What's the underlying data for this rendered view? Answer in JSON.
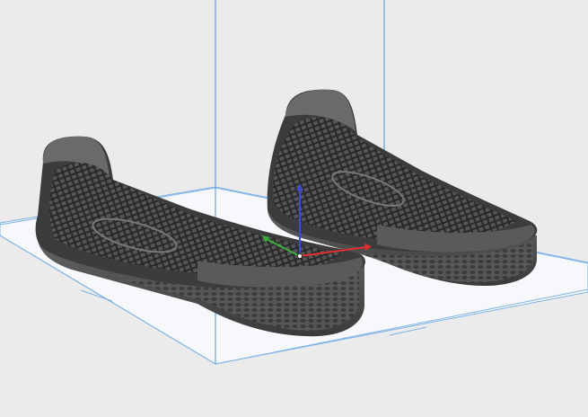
{
  "viewport": {
    "background": "#ebebeb",
    "build_plate_color": "#f7f9fb",
    "build_volume_edge_color": "#4a90d9",
    "model_color": "#4a4a4a",
    "model_highlight_color": "#7a7a7a",
    "model_dark_color": "#1e1e1e"
  },
  "models": [
    {
      "name": "left-shoe-sole"
    },
    {
      "name": "right-shoe-sole"
    }
  ],
  "gizmo": {
    "x_color": "#e03030",
    "y_color": "#3ab03a",
    "z_color": "#3a4bd0"
  },
  "dimension_labels": {
    "width_label": "",
    "depth_label": ""
  }
}
